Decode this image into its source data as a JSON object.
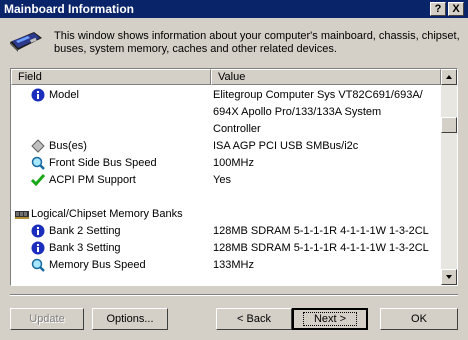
{
  "window": {
    "title": "Mainboard Information",
    "help_label": "?",
    "close_label": "X"
  },
  "header": {
    "icon": "mainboard-card-icon",
    "description": "This window shows information about your computer's mainboard, chassis, chipset, buses, system memory, caches and other related devices."
  },
  "list": {
    "columns": {
      "field": "Field",
      "value": "Value"
    },
    "rows": [
      {
        "icon": "info-icon",
        "field": "Model",
        "value": "Elitegroup Computer Sys VT82C691/693A/"
      },
      {
        "icon": "",
        "field": "",
        "value": "694X Apollo Pro/133/133A System"
      },
      {
        "icon": "",
        "field": "",
        "value": "Controller"
      },
      {
        "icon": "bus-diamond-icon",
        "field": "Bus(es)",
        "value": "ISA AGP PCI USB SMBus/i2c"
      },
      {
        "icon": "magnifier-icon",
        "field": "Front Side Bus Speed",
        "value": "100MHz"
      },
      {
        "icon": "checkmark-icon",
        "field": "ACPI PM Support",
        "value": "Yes"
      },
      {
        "icon": "",
        "field": "",
        "value": ""
      },
      {
        "icon": "memory-chip-icon",
        "field": "Logical/Chipset Memory Banks",
        "value": ""
      },
      {
        "icon": "info-icon",
        "field": "Bank 2 Setting",
        "value": "128MB SDRAM 5-1-1-1R 4-1-1-1W 1-3-2CL"
      },
      {
        "icon": "info-icon",
        "field": "Bank 3 Setting",
        "value": "128MB SDRAM 5-1-1-1R 4-1-1-1W 1-3-2CL"
      },
      {
        "icon": "magnifier-icon",
        "field": "Memory Bus Speed",
        "value": "133MHz"
      }
    ]
  },
  "buttons": {
    "update": {
      "label": "Update",
      "underline": "U",
      "disabled": true
    },
    "options": {
      "label": "Options...",
      "underline": "O"
    },
    "back": {
      "label": "< Back",
      "underline": "B"
    },
    "next": {
      "label": "Next >",
      "underline": "N",
      "default": true
    },
    "ok": {
      "label": "OK"
    }
  }
}
